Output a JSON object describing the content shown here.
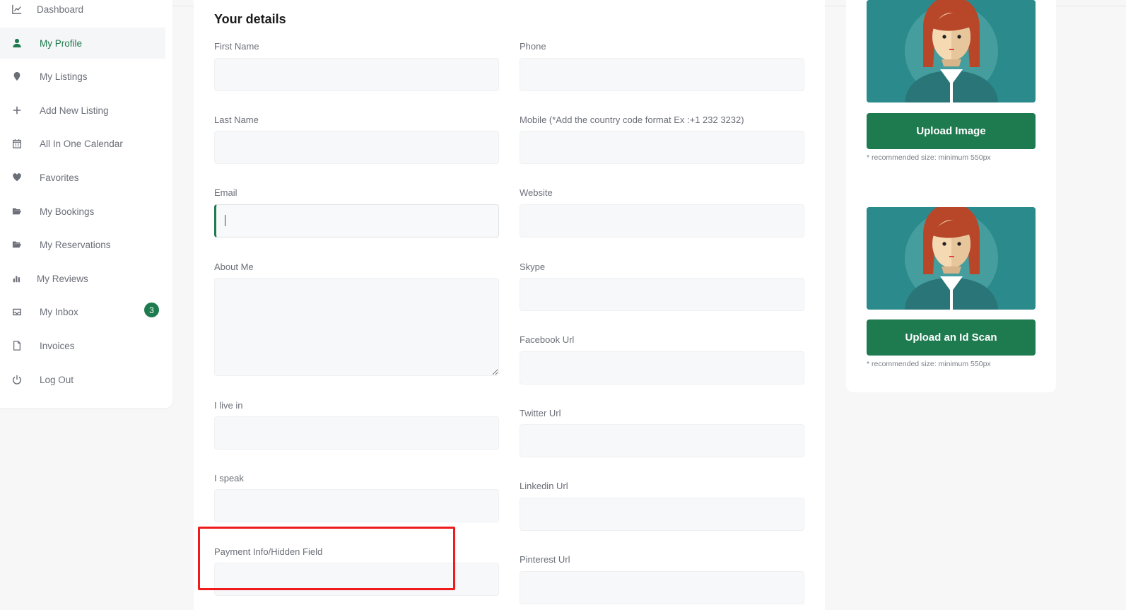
{
  "sidebar": {
    "items": [
      {
        "label": "Dashboard",
        "icon": "chart-icon",
        "active": false
      },
      {
        "label": "My Profile",
        "icon": "user-icon",
        "active": true
      },
      {
        "label": "My Listings",
        "icon": "map-pin-icon",
        "active": false
      },
      {
        "label": "Add New Listing",
        "icon": "plus-icon",
        "active": false
      },
      {
        "label": "All In One Calendar",
        "icon": "calendar-icon",
        "active": false
      },
      {
        "label": "Favorites",
        "icon": "heart-icon",
        "active": false
      },
      {
        "label": "My Bookings",
        "icon": "folder-open-icon",
        "active": false
      },
      {
        "label": "My Reservations",
        "icon": "folder-open-icon",
        "active": false
      },
      {
        "label": "My Reviews",
        "icon": "bar-chart-icon",
        "active": false
      },
      {
        "label": "My Inbox",
        "icon": "inbox-icon",
        "active": false,
        "badge": "3"
      },
      {
        "label": "Invoices",
        "icon": "file-icon",
        "active": false
      },
      {
        "label": "Log Out",
        "icon": "power-icon",
        "active": false
      }
    ]
  },
  "form": {
    "title": "Your details",
    "left_fields": {
      "first_name": {
        "label": "First Name",
        "value": ""
      },
      "last_name": {
        "label": "Last Name",
        "value": ""
      },
      "email": {
        "label": "Email",
        "value": ""
      },
      "about_me": {
        "label": "About Me",
        "value": ""
      },
      "live_in": {
        "label": "I live in",
        "value": ""
      },
      "speak": {
        "label": "I speak",
        "value": ""
      },
      "payment": {
        "label": "Payment Info/Hidden Field",
        "value": ""
      }
    },
    "right_fields": {
      "phone": {
        "label": "Phone",
        "value": ""
      },
      "mobile": {
        "label": "Mobile (*Add the country code format Ex :+1 232 3232)",
        "value": ""
      },
      "website": {
        "label": "Website",
        "value": ""
      },
      "skype": {
        "label": "Skype",
        "value": ""
      },
      "facebook": {
        "label": "Facebook Url",
        "value": ""
      },
      "twitter": {
        "label": "Twitter Url",
        "value": ""
      },
      "linkedin": {
        "label": "Linkedin Url",
        "value": ""
      },
      "pinterest": {
        "label": "Pinterest Url",
        "value": ""
      }
    }
  },
  "uploads": {
    "image_button": "Upload Image",
    "image_hint": "* recommended size: minimum 550px",
    "id_button": "Upload an Id Scan",
    "id_hint": "* recommended size: minimum 550px"
  },
  "colors": {
    "accent": "#1e7a4f",
    "avatar_bg": "#2a8a8c",
    "highlight": "#ee1c1c"
  }
}
